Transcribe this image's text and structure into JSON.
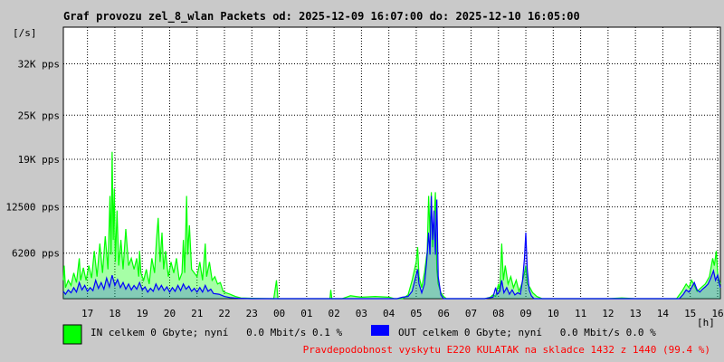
{
  "chart_data": {
    "type": "area",
    "title": "Graf provozu zel_8_wlan Packets od: 2025-12-09 16:07:00 do: 2025-12-10 16:05:00",
    "ylabel": "[/s]",
    "xlabel": "[h]",
    "ylim": [
      0,
      37000
    ],
    "y_ticks": [
      {
        "value": 6200,
        "label": "6200 pps"
      },
      {
        "value": 12500,
        "label": "12500 pps"
      },
      {
        "value": 19000,
        "label": "19K pps"
      },
      {
        "value": 25000,
        "label": "25K pps"
      },
      {
        "value": 32000,
        "label": "32K pps"
      }
    ],
    "x_unit": "hours",
    "x_range": [
      16.12,
      40.1
    ],
    "x_ticks": [
      {
        "value": 17,
        "label": "17"
      },
      {
        "value": 18,
        "label": "18"
      },
      {
        "value": 19,
        "label": "19"
      },
      {
        "value": 20,
        "label": "20"
      },
      {
        "value": 21,
        "label": "21"
      },
      {
        "value": 22,
        "label": "22"
      },
      {
        "value": 23,
        "label": "23"
      },
      {
        "value": 24,
        "label": "00"
      },
      {
        "value": 25,
        "label": "01"
      },
      {
        "value": 26,
        "label": "02"
      },
      {
        "value": 27,
        "label": "03"
      },
      {
        "value": 28,
        "label": "04"
      },
      {
        "value": 29,
        "label": "05"
      },
      {
        "value": 30,
        "label": "06"
      },
      {
        "value": 31,
        "label": "07"
      },
      {
        "value": 32,
        "label": "08"
      },
      {
        "value": 33,
        "label": "09"
      },
      {
        "value": 34,
        "label": "10"
      },
      {
        "value": 35,
        "label": "11"
      },
      {
        "value": 36,
        "label": "12"
      },
      {
        "value": 37,
        "label": "13"
      },
      {
        "value": 38,
        "label": "14"
      },
      {
        "value": 39,
        "label": "15"
      },
      {
        "value": 40,
        "label": "16"
      }
    ],
    "grid": true,
    "series": [
      {
        "name": "IN",
        "color": "#00ff00",
        "points": [
          [
            16.12,
            2500
          ],
          [
            16.15,
            4500
          ],
          [
            16.2,
            1500
          ],
          [
            16.3,
            2500
          ],
          [
            16.4,
            1800
          ],
          [
            16.5,
            3500
          ],
          [
            16.6,
            2200
          ],
          [
            16.7,
            5500
          ],
          [
            16.75,
            2500
          ],
          [
            16.85,
            4200
          ],
          [
            16.95,
            2500
          ],
          [
            17.05,
            4500
          ],
          [
            17.15,
            2800
          ],
          [
            17.25,
            6500
          ],
          [
            17.35,
            3000
          ],
          [
            17.45,
            7500
          ],
          [
            17.55,
            3500
          ],
          [
            17.65,
            8500
          ],
          [
            17.75,
            4000
          ],
          [
            17.82,
            14000
          ],
          [
            17.86,
            6000
          ],
          [
            17.9,
            20000
          ],
          [
            17.94,
            8000
          ],
          [
            17.98,
            15000
          ],
          [
            18.02,
            5000
          ],
          [
            18.08,
            12000
          ],
          [
            18.14,
            4500
          ],
          [
            18.22,
            8000
          ],
          [
            18.3,
            4000
          ],
          [
            18.4,
            9500
          ],
          [
            18.5,
            4500
          ],
          [
            18.6,
            5500
          ],
          [
            18.7,
            4000
          ],
          [
            18.8,
            5500
          ],
          [
            18.87,
            3000
          ],
          [
            18.9,
            6500
          ],
          [
            18.95,
            3500
          ],
          [
            19.05,
            2500
          ],
          [
            19.15,
            4000
          ],
          [
            19.25,
            2000
          ],
          [
            19.35,
            5500
          ],
          [
            19.45,
            3500
          ],
          [
            19.52,
            8000
          ],
          [
            19.58,
            11000
          ],
          [
            19.65,
            5000
          ],
          [
            19.72,
            9000
          ],
          [
            19.78,
            4000
          ],
          [
            19.85,
            6500
          ],
          [
            19.95,
            3000
          ],
          [
            20.05,
            5000
          ],
          [
            20.15,
            3500
          ],
          [
            20.25,
            5500
          ],
          [
            20.35,
            2500
          ],
          [
            20.45,
            3500
          ],
          [
            20.5,
            8000
          ],
          [
            20.55,
            3500
          ],
          [
            20.62,
            14000
          ],
          [
            20.66,
            6000
          ],
          [
            20.72,
            10000
          ],
          [
            20.8,
            4000
          ],
          [
            20.9,
            3500
          ],
          [
            21.0,
            3000
          ],
          [
            21.1,
            5000
          ],
          [
            21.2,
            2500
          ],
          [
            21.3,
            7500
          ],
          [
            21.35,
            3000
          ],
          [
            21.45,
            5000
          ],
          [
            21.55,
            2500
          ],
          [
            21.65,
            3000
          ],
          [
            21.75,
            2000
          ],
          [
            21.85,
            2200
          ],
          [
            21.95,
            1000
          ],
          [
            22.05,
            800
          ],
          [
            22.2,
            600
          ],
          [
            22.4,
            300
          ],
          [
            22.6,
            100
          ],
          [
            23.0,
            50
          ],
          [
            23.8,
            0
          ],
          [
            23.9,
            2500
          ],
          [
            23.95,
            0
          ],
          [
            24.1,
            0
          ],
          [
            24.5,
            0
          ],
          [
            25.0,
            0
          ],
          [
            25.5,
            0
          ],
          [
            25.85,
            0
          ],
          [
            25.88,
            1200
          ],
          [
            25.92,
            0
          ],
          [
            26.3,
            0
          ],
          [
            26.6,
            400
          ],
          [
            26.8,
            300
          ],
          [
            27.0,
            200
          ],
          [
            27.5,
            300
          ],
          [
            28.0,
            200
          ],
          [
            28.2,
            0
          ],
          [
            28.5,
            0
          ],
          [
            28.7,
            500
          ],
          [
            28.85,
            2500
          ],
          [
            29.0,
            5000
          ],
          [
            29.05,
            7000
          ],
          [
            29.1,
            3000
          ],
          [
            29.2,
            1500
          ],
          [
            29.3,
            3500
          ],
          [
            29.4,
            6500
          ],
          [
            29.45,
            14000
          ],
          [
            29.5,
            9000
          ],
          [
            29.55,
            14500
          ],
          [
            29.6,
            7000
          ],
          [
            29.7,
            14500
          ],
          [
            29.75,
            4000
          ],
          [
            29.8,
            2000
          ],
          [
            29.9,
            800
          ],
          [
            30.0,
            300
          ],
          [
            30.1,
            0
          ],
          [
            30.5,
            0
          ],
          [
            31.5,
            0
          ],
          [
            31.7,
            200
          ],
          [
            31.8,
            500
          ],
          [
            31.9,
            300
          ],
          [
            32.0,
            2000
          ],
          [
            32.05,
            1000
          ],
          [
            32.12,
            7500
          ],
          [
            32.18,
            2500
          ],
          [
            32.25,
            4500
          ],
          [
            32.35,
            2000
          ],
          [
            32.45,
            3000
          ],
          [
            32.55,
            1500
          ],
          [
            32.65,
            2500
          ],
          [
            32.75,
            1000
          ],
          [
            32.85,
            2000
          ],
          [
            32.95,
            3500
          ],
          [
            33.0,
            4500
          ],
          [
            33.05,
            2000
          ],
          [
            33.15,
            1500
          ],
          [
            33.25,
            800
          ],
          [
            33.4,
            300
          ],
          [
            33.6,
            0
          ],
          [
            36.0,
            0
          ],
          [
            36.5,
            100
          ],
          [
            37.0,
            0
          ],
          [
            38.5,
            0
          ],
          [
            38.7,
            1000
          ],
          [
            38.85,
            2000
          ],
          [
            38.95,
            1500
          ],
          [
            39.05,
            2500
          ],
          [
            39.15,
            1800
          ],
          [
            39.25,
            1000
          ],
          [
            39.4,
            1500
          ],
          [
            39.55,
            2000
          ],
          [
            39.7,
            3000
          ],
          [
            39.82,
            5500
          ],
          [
            39.88,
            4500
          ],
          [
            39.95,
            6500
          ],
          [
            40.0,
            3500
          ],
          [
            40.05,
            2500
          ],
          [
            40.1,
            2000
          ]
        ]
      },
      {
        "name": "OUT",
        "color": "#0000ff",
        "points": [
          [
            16.12,
            1000
          ],
          [
            16.2,
            600
          ],
          [
            16.3,
            1200
          ],
          [
            16.4,
            800
          ],
          [
            16.5,
            1500
          ],
          [
            16.6,
            900
          ],
          [
            16.7,
            2200
          ],
          [
            16.8,
            1200
          ],
          [
            16.9,
            1800
          ],
          [
            17.0,
            1000
          ],
          [
            17.1,
            1500
          ],
          [
            17.2,
            1100
          ],
          [
            17.3,
            2500
          ],
          [
            17.4,
            1400
          ],
          [
            17.5,
            2200
          ],
          [
            17.6,
            1300
          ],
          [
            17.7,
            2800
          ],
          [
            17.8,
            1600
          ],
          [
            17.9,
            3200
          ],
          [
            18.0,
            1800
          ],
          [
            18.1,
            2600
          ],
          [
            18.2,
            1500
          ],
          [
            18.3,
            2200
          ],
          [
            18.4,
            1300
          ],
          [
            18.5,
            2000
          ],
          [
            18.6,
            1200
          ],
          [
            18.7,
            1800
          ],
          [
            18.8,
            1300
          ],
          [
            18.9,
            2200
          ],
          [
            19.0,
            1200
          ],
          [
            19.1,
            1600
          ],
          [
            19.2,
            900
          ],
          [
            19.3,
            1400
          ],
          [
            19.4,
            1000
          ],
          [
            19.5,
            2000
          ],
          [
            19.6,
            1200
          ],
          [
            19.7,
            1800
          ],
          [
            19.8,
            1100
          ],
          [
            19.9,
            1600
          ],
          [
            20.0,
            900
          ],
          [
            20.1,
            1500
          ],
          [
            20.2,
            1000
          ],
          [
            20.3,
            1800
          ],
          [
            20.4,
            1100
          ],
          [
            20.5,
            2000
          ],
          [
            20.6,
            1300
          ],
          [
            20.7,
            1700
          ],
          [
            20.8,
            1000
          ],
          [
            20.9,
            1400
          ],
          [
            21.0,
            900
          ],
          [
            21.1,
            1500
          ],
          [
            21.2,
            900
          ],
          [
            21.3,
            1800
          ],
          [
            21.4,
            1000
          ],
          [
            21.5,
            1300
          ],
          [
            21.6,
            700
          ],
          [
            21.8,
            600
          ],
          [
            22.0,
            300
          ],
          [
            22.2,
            150
          ],
          [
            22.5,
            50
          ],
          [
            23.0,
            0
          ],
          [
            28.3,
            0
          ],
          [
            28.5,
            200
          ],
          [
            28.7,
            300
          ],
          [
            28.85,
            1000
          ],
          [
            28.95,
            2500
          ],
          [
            29.05,
            4000
          ],
          [
            29.1,
            2000
          ],
          [
            29.2,
            800
          ],
          [
            29.3,
            2000
          ],
          [
            29.38,
            5000
          ],
          [
            29.45,
            9000
          ],
          [
            29.5,
            6000
          ],
          [
            29.55,
            14000
          ],
          [
            29.6,
            8000
          ],
          [
            29.65,
            12000
          ],
          [
            29.7,
            6000
          ],
          [
            29.75,
            13500
          ],
          [
            29.8,
            3000
          ],
          [
            29.9,
            500
          ],
          [
            30.0,
            0
          ],
          [
            31.5,
            0
          ],
          [
            31.8,
            200
          ],
          [
            31.9,
            1500
          ],
          [
            31.95,
            600
          ],
          [
            32.05,
            1000
          ],
          [
            32.12,
            2500
          ],
          [
            32.2,
            800
          ],
          [
            32.3,
            1500
          ],
          [
            32.4,
            600
          ],
          [
            32.5,
            1200
          ],
          [
            32.6,
            500
          ],
          [
            32.7,
            800
          ],
          [
            32.8,
            600
          ],
          [
            32.88,
            2500
          ],
          [
            32.95,
            5500
          ],
          [
            33.0,
            9000
          ],
          [
            33.05,
            4000
          ],
          [
            33.12,
            1200
          ],
          [
            33.2,
            400
          ],
          [
            33.3,
            0
          ],
          [
            38.6,
            0
          ],
          [
            38.75,
            600
          ],
          [
            38.85,
            1200
          ],
          [
            38.95,
            900
          ],
          [
            39.05,
            1500
          ],
          [
            39.15,
            2200
          ],
          [
            39.25,
            1200
          ],
          [
            39.35,
            900
          ],
          [
            39.45,
            1300
          ],
          [
            39.55,
            1600
          ],
          [
            39.65,
            2000
          ],
          [
            39.75,
            2800
          ],
          [
            39.85,
            3800
          ],
          [
            39.92,
            2500
          ],
          [
            40.0,
            3200
          ],
          [
            40.05,
            2200
          ],
          [
            40.1,
            1500
          ]
        ]
      }
    ]
  },
  "legend": {
    "in": {
      "color": "#00ff00",
      "text": "IN celkem 0 Gbyte; nyní   0.0 Mbit/s 0.1 %"
    },
    "out": {
      "color": "#0000ff",
      "text": "OUT celkem 0 Gbyte; nyní   0.0 Mbit/s 0.0 %"
    }
  },
  "footer": {
    "text": "Pravdepodobnost vyskytu E220 KULATAK na skladce 1432 z 1440 (99.4 %)",
    "color": "#ff0000"
  }
}
